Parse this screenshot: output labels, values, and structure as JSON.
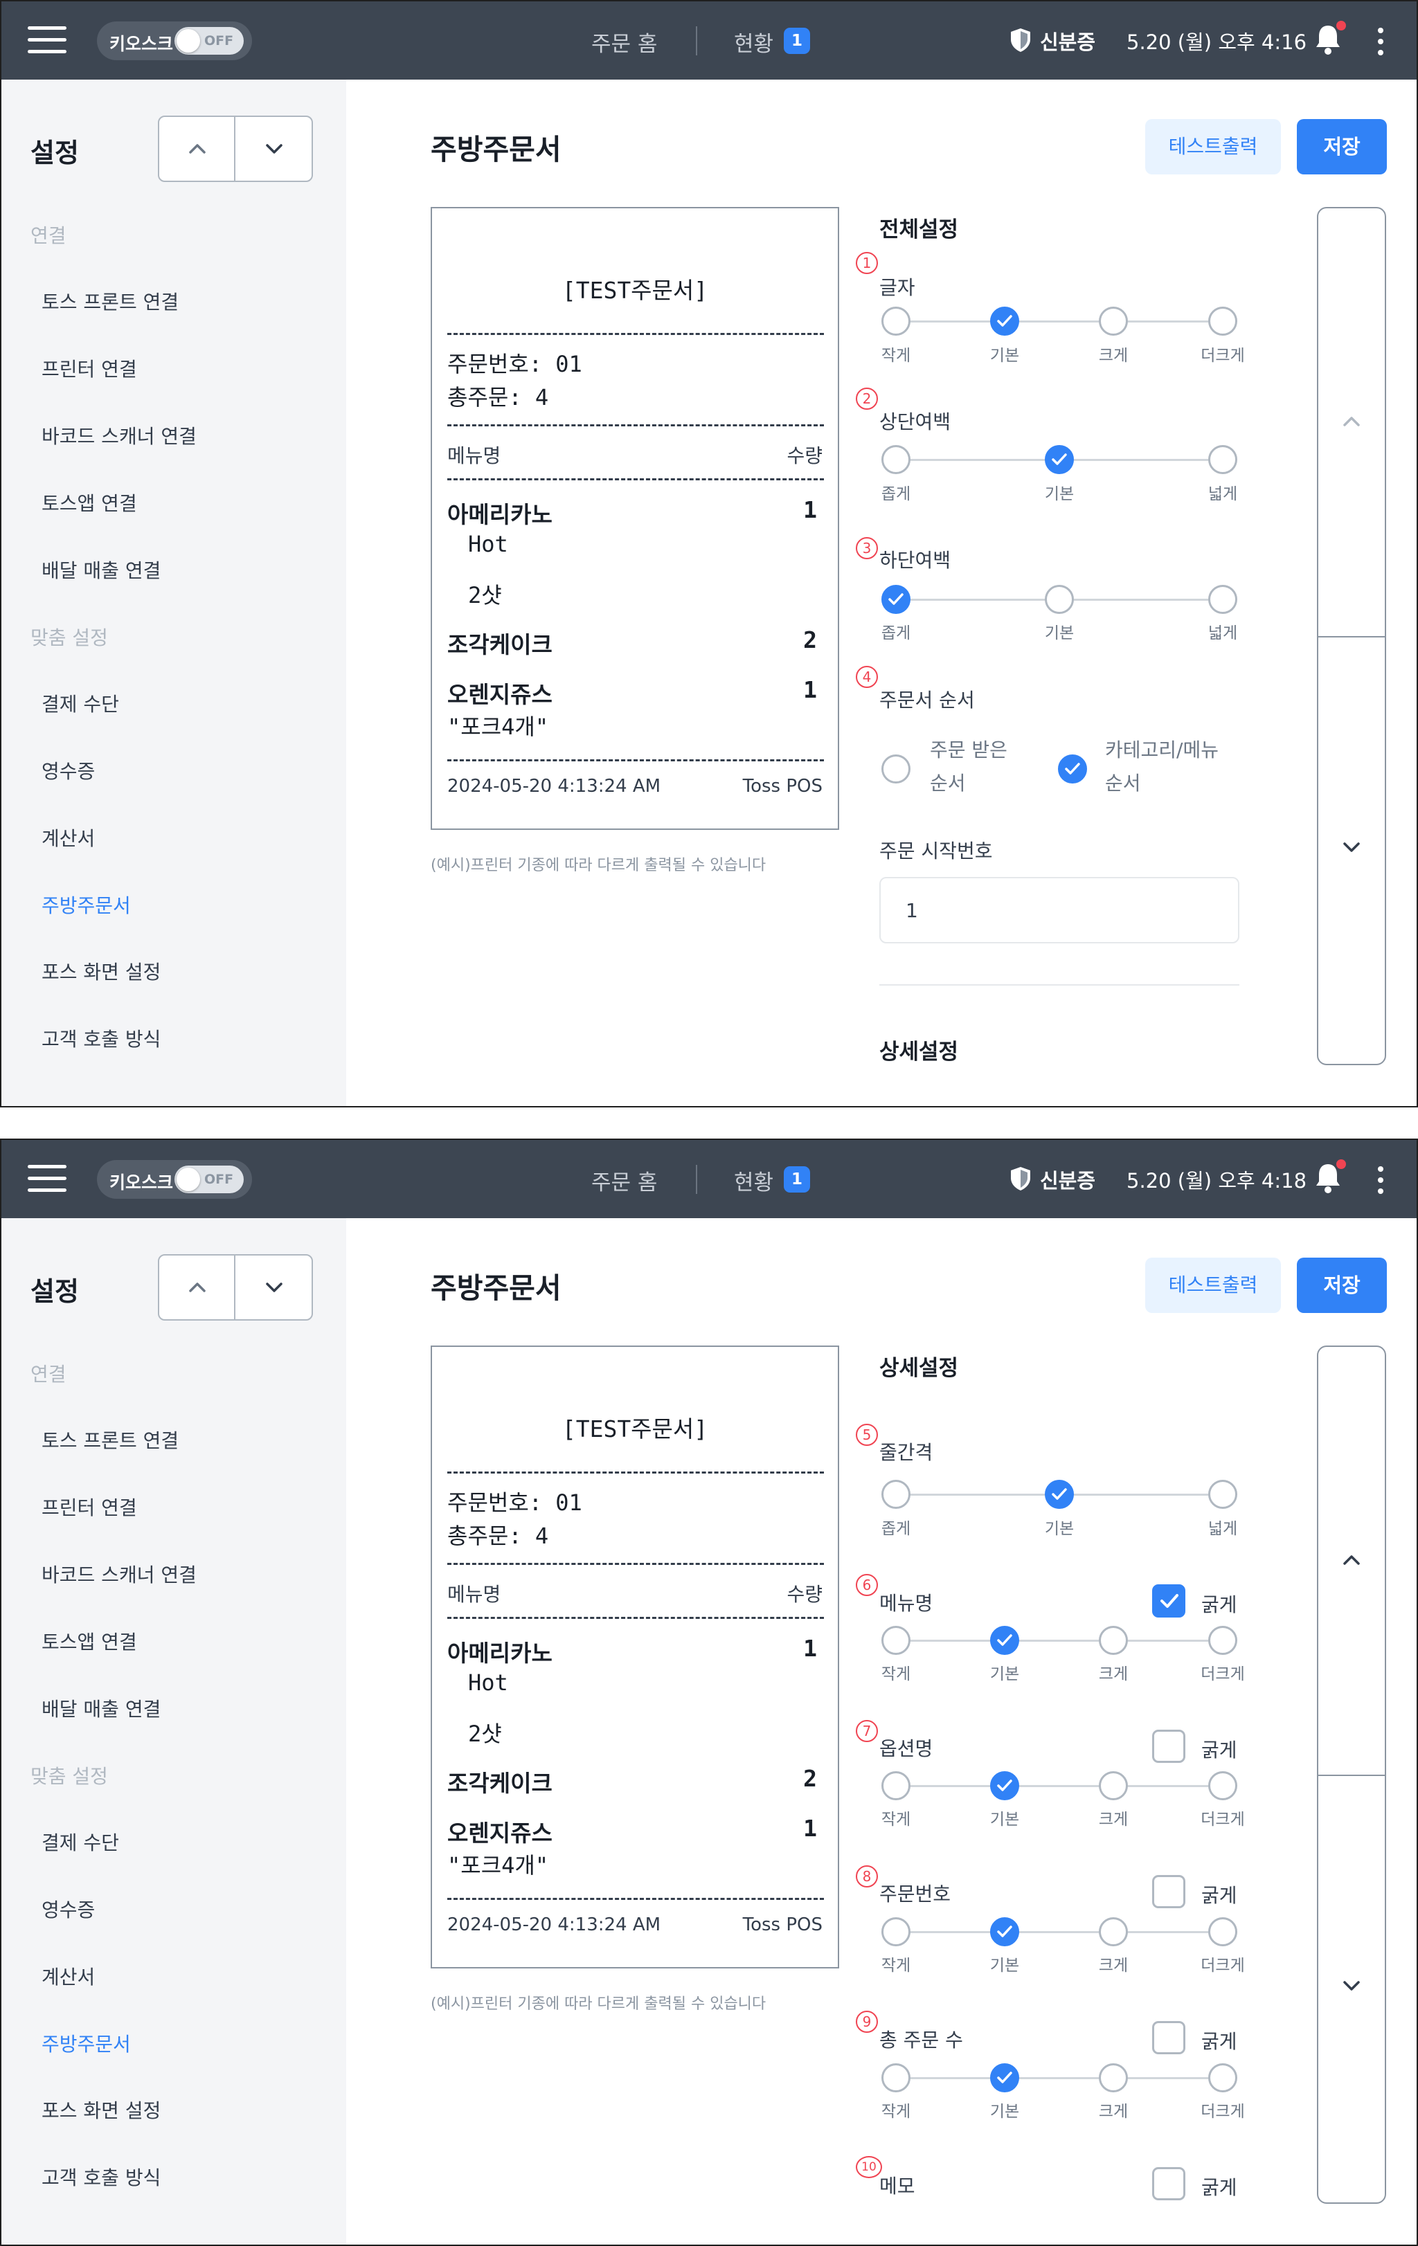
{
  "common": {
    "kiosk_label": "키오스크",
    "kiosk_toggle": "OFF",
    "nav_home": "주문 홈",
    "nav_status": "현황",
    "nav_badge": "1",
    "verify_label": "신분증",
    "sidebar_title": "설정",
    "sidebar_group_connect": "연결",
    "sidebar_group_custom": "맞춤 설정",
    "sidebar_items": [
      "토스 프론트 연결",
      "프린터 연결",
      "바코드 스캐너 연결",
      "토스앱 연결",
      "배달 매출 연결",
      "결제 수단",
      "영수증",
      "계산서",
      "주방주문서",
      "포스 화면 설정",
      "고객 호출 방식"
    ],
    "page_title": "주방주문서",
    "btn_test": "테스트출력",
    "btn_save": "저장",
    "receipt_note": "(예시)프린터 기종에 따라 다르게 출력될 수 있습니다",
    "colors": {
      "topbar": "#3d4652",
      "accent": "#3182f6",
      "marker": "#f04452"
    }
  },
  "receipt": {
    "title": "[TEST주문서]",
    "order_no": "주문번호: 01",
    "total": "총주문: 4",
    "col_menu": "메뉴명",
    "col_qty": "수량",
    "items": [
      {
        "name": "아메리카노",
        "qty": "1",
        "options": [
          "Hot",
          "2샷"
        ]
      },
      {
        "name": "조각케이크",
        "qty": "2",
        "options": []
      },
      {
        "name": "오렌지쥬스",
        "qty": "1",
        "memo": "\"포크4개\""
      }
    ],
    "timestamp": "2024-05-20 4:13:24 AM",
    "brand": "Toss POS"
  },
  "screen1": {
    "datetime": "5.20 (월) 오후 4:16",
    "section_general": "전체설정",
    "section_detail": "상세설정",
    "font": {
      "num": "1",
      "label": "글자",
      "options": [
        "작게",
        "기본",
        "크게",
        "더크게"
      ],
      "selected": 1
    },
    "top_margin": {
      "num": "2",
      "label": "상단여백",
      "options": [
        "좁게",
        "기본",
        "넓게"
      ],
      "selected": 1
    },
    "bottom_margin": {
      "num": "3",
      "label": "하단여백",
      "options": [
        "좁게",
        "기본",
        "넓게"
      ],
      "selected": 0
    },
    "order_sequence": {
      "num": "4",
      "label": "주문서 순서",
      "options": [
        "주문 받은 순서",
        "카테고리/메뉴 순서"
      ],
      "opt1_line1": "주문 받은",
      "opt1_line2": "순서",
      "opt2_line1": "카테고리/메뉴",
      "opt2_line2": "순서",
      "selected": 1
    },
    "start_number": {
      "label": "주문 시작번호",
      "value": "1"
    }
  },
  "screen2": {
    "datetime": "5.20 (월) 오후 4:18",
    "section_detail": "상세설정",
    "bold_label": "굵게",
    "line_spacing": {
      "num": "5",
      "label": "줄간격",
      "options": [
        "좁게",
        "기본",
        "넓게"
      ],
      "selected": 1
    },
    "menu_name": {
      "num": "6",
      "label": "메뉴명",
      "options": [
        "작게",
        "기본",
        "크게",
        "더크게"
      ],
      "selected": 1,
      "bold": true
    },
    "option_name": {
      "num": "7",
      "label": "옵션명",
      "options": [
        "작게",
        "기본",
        "크게",
        "더크게"
      ],
      "selected": 1,
      "bold": false
    },
    "order_number": {
      "num": "8",
      "label": "주문번호",
      "options": [
        "작게",
        "기본",
        "크게",
        "더크게"
      ],
      "selected": 1,
      "bold": false
    },
    "total_orders": {
      "num": "9",
      "label": "총 주문 수",
      "options": [
        "작게",
        "기본",
        "크게",
        "더크게"
      ],
      "selected": 1,
      "bold": false
    },
    "memo": {
      "num": "10",
      "label": "메모",
      "bold": false
    }
  }
}
